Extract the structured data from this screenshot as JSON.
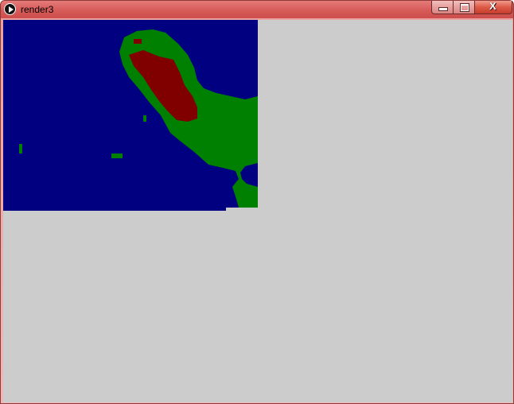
{
  "window": {
    "title": "render3",
    "icon": "processing-play-icon",
    "controls": {
      "minimize_icon": "minimize-icon",
      "maximize_icon": "maximize-icon",
      "close_icon": "close-icon",
      "close_glyph": "X"
    }
  },
  "render": {
    "colors": {
      "background": "#cccccc",
      "water": "#000080",
      "land": "#008000",
      "peak": "#800000"
    }
  }
}
